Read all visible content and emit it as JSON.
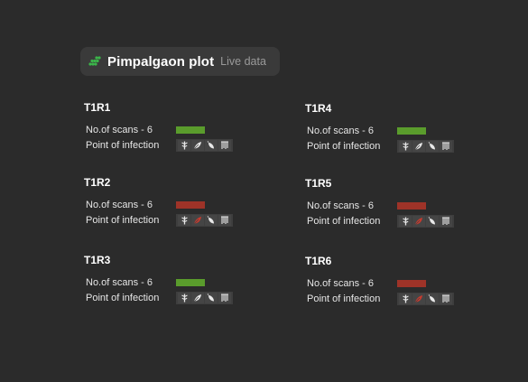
{
  "header": {
    "logo_icon": "leaf-cluster-icon",
    "title": "Pimpalgaon plot",
    "status": "Live data",
    "logo_color": "#3bb54a"
  },
  "colors": {
    "healthy": "#5a9c2c",
    "infected": "#9e3328",
    "icon_default": "#e8e8e8",
    "icon_infected": "#c83a2e"
  },
  "plots": [
    {
      "name": "T1R1",
      "scans_label": "No.of scans - 6",
      "infection_label": "Point of infection",
      "status": "healthy",
      "infected_part": null
    },
    {
      "name": "T1R2",
      "scans_label": "No.of scans - 6",
      "infection_label": "Point of infection",
      "status": "infected",
      "infected_part": "leaf"
    },
    {
      "name": "T1R3",
      "scans_label": "No.of scans - 6",
      "infection_label": "Point of infection",
      "status": "healthy",
      "infected_part": null
    },
    {
      "name": "T1R4",
      "scans_label": "No.of scans - 6",
      "infection_label": "Point of infection",
      "status": "healthy",
      "infected_part": null
    },
    {
      "name": "T1R5",
      "scans_label": "No.of scans - 6",
      "infection_label": "Point of infection",
      "status": "infected",
      "infected_part": "leaf"
    },
    {
      "name": "T1R6",
      "scans_label": "No.of scans - 6",
      "infection_label": "Point of infection",
      "status": "infected",
      "infected_part": "leaf"
    }
  ],
  "infection_icons": [
    "stem-icon",
    "leaf-icon",
    "fruit-icon",
    "root-icon"
  ]
}
